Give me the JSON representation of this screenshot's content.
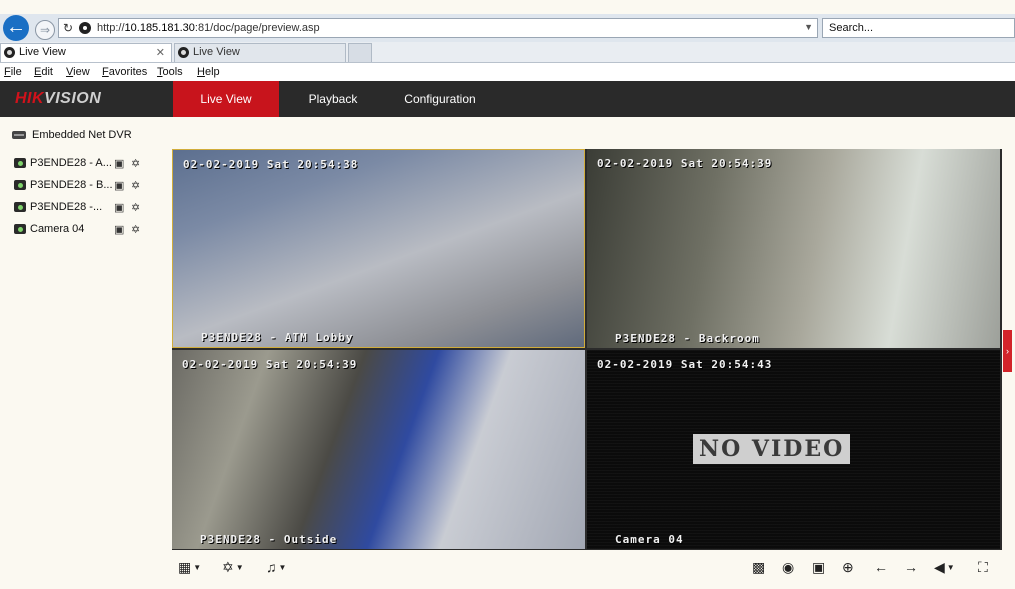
{
  "browser": {
    "url_prefix": "http://",
    "url_host": "10.185.181.30",
    "url_rest": ":81/doc/page/preview.asp",
    "search_placeholder": "Search...",
    "tabs": [
      {
        "label": "Live View",
        "active": true
      },
      {
        "label": "Live View",
        "active": false
      }
    ],
    "menu": [
      "File",
      "Edit",
      "View",
      "Favorites",
      "Tools",
      "Help"
    ]
  },
  "app": {
    "logo_main": "HIK",
    "logo_rest": "VISION",
    "nav": [
      {
        "label": "Live View",
        "active": true
      },
      {
        "label": "Playback",
        "active": false
      },
      {
        "label": "Configuration",
        "active": false
      }
    ]
  },
  "sidebar": {
    "device": "Embedded Net DVR",
    "cameras": [
      {
        "label": "P3ENDE28 - A..."
      },
      {
        "label": "P3ENDE28 - B..."
      },
      {
        "label": "P3ENDE28 -..."
      },
      {
        "label": "Camera 04"
      }
    ]
  },
  "views": [
    {
      "timestamp": "02-02-2019 Sat 20:54:38",
      "name": "P3ENDE28 - ATM Lobby"
    },
    {
      "timestamp": "02-02-2019 Sat 20:54:39",
      "name": "P3ENDE28 - Backroom"
    },
    {
      "timestamp": "02-02-2019 Sat 20:54:39",
      "name": "P3ENDE28 - Outside"
    },
    {
      "timestamp": "02-02-2019 Sat 20:54:43",
      "name": "Camera 04",
      "status": "NO VIDEO"
    }
  ],
  "colors": {
    "accent": "#c8141c",
    "selected_border": "#d1ad3b"
  }
}
